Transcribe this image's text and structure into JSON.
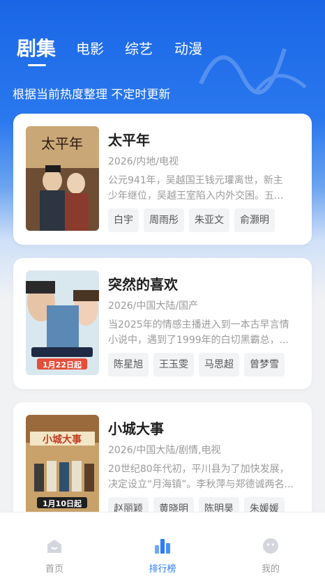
{
  "tabs": [
    {
      "label": "剧集",
      "active": true
    },
    {
      "label": "电影",
      "active": false
    },
    {
      "label": "综艺",
      "active": false
    },
    {
      "label": "动漫",
      "active": false
    }
  ],
  "subtitle": "根据当前热度整理 不定时更新",
  "cards": [
    {
      "title": "太平年",
      "meta": "2026/内地/电视",
      "desc_line1": "公元941年，吴越国王钱元瓘离世，新主",
      "desc_line2": "少年继位，吴越王室陷入内外交困。五...",
      "actors": [
        "白宇",
        "周雨彤",
        "朱亚文",
        "俞灏明"
      ],
      "poster_title": "太平年"
    },
    {
      "title": "突然的喜欢",
      "meta": "2026/中国大陆/国产",
      "desc_line1": "当2025年的情感主播进入到一本古早言情",
      "desc_line2": "小说中，遇到了1999年的白切黑霸总，...",
      "actors": [
        "陈星旭",
        "王玉雯",
        "马思超",
        "曾梦雪"
      ],
      "poster_date": "1月22日起"
    },
    {
      "title": "小城大事",
      "meta": "2026/中国大陆/剧情,电视",
      "desc_line1": "20世纪80年代初，平川县为了加快发展，",
      "desc_line2": "决定设立“月海镇”。李秋萍与郑德诚两名...",
      "actors": [
        "赵丽颖",
        "黄晓明",
        "陈明昊",
        "朱媛媛"
      ],
      "poster_title": "小城大事",
      "poster_date": "1月10日起"
    }
  ],
  "bottom_nav": [
    {
      "label": "首页",
      "icon": "home-icon",
      "active": false
    },
    {
      "label": "排行榜",
      "icon": "ranking-icon",
      "active": true
    },
    {
      "label": "我的",
      "icon": "profile-icon",
      "active": false
    }
  ],
  "colors": {
    "accent": "#2b7cf5",
    "hero": "#1a66e6"
  }
}
